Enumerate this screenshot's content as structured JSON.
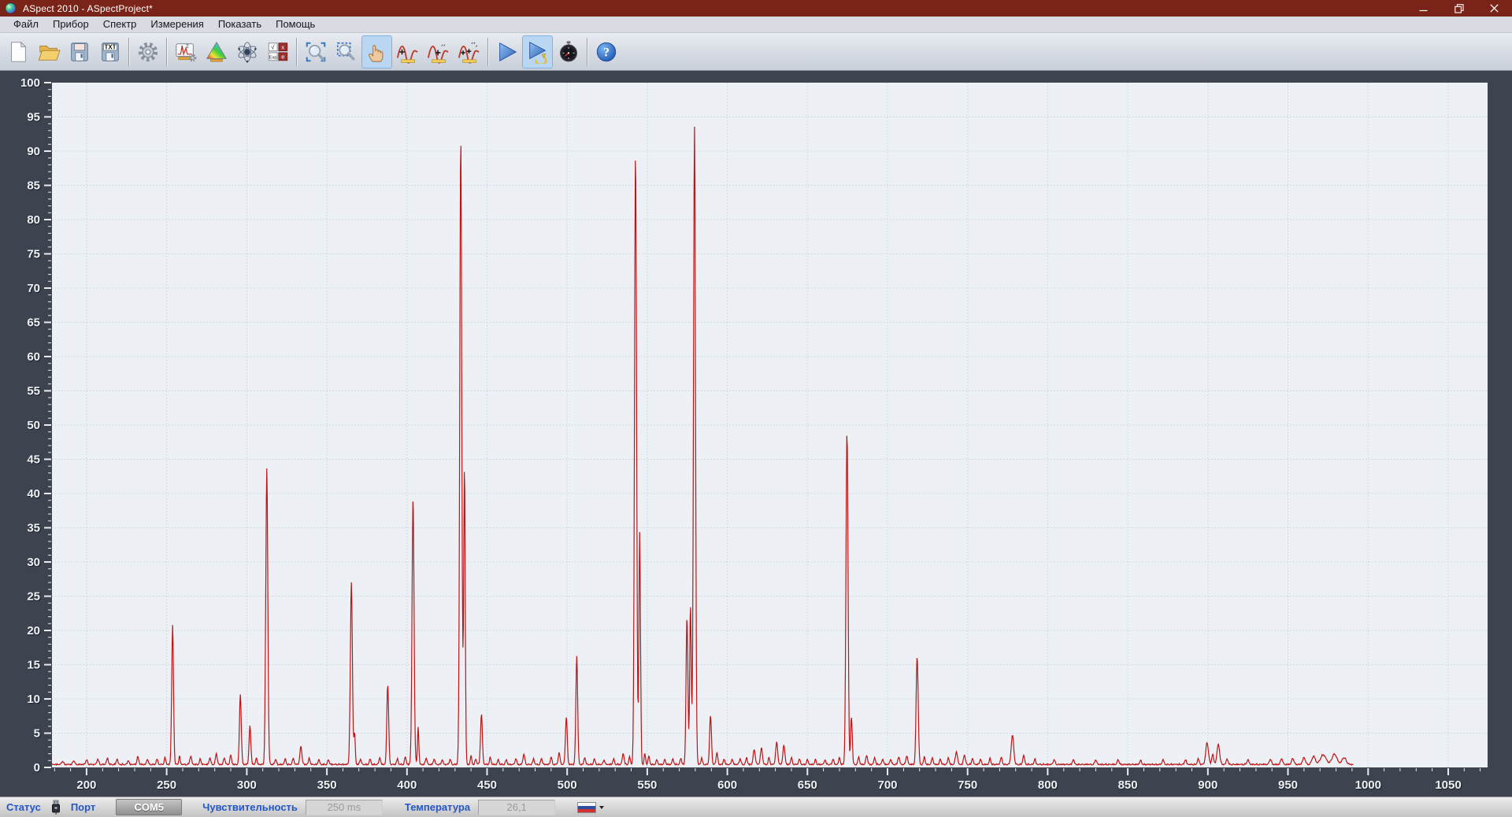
{
  "window": {
    "title": "ASpect 2010 - ASpectProject*",
    "app_icon": "aspect-sphere-icon",
    "controls": [
      "minimize-icon",
      "restore-icon",
      "close-icon"
    ]
  },
  "menu": {
    "items": [
      "Файл",
      "Прибор",
      "Спектр",
      "Измерения",
      "Показать",
      "Помощь"
    ]
  },
  "toolbar": {
    "items": [
      {
        "type": "button",
        "name": "new-file",
        "icon": "new-file-icon"
      },
      {
        "type": "button",
        "name": "open-file",
        "icon": "open-folder-icon"
      },
      {
        "type": "button",
        "name": "save",
        "icon": "save-floppy-icon"
      },
      {
        "type": "button",
        "name": "save-txt",
        "icon": "save-txt-icon"
      },
      {
        "type": "separator"
      },
      {
        "type": "button",
        "name": "settings",
        "icon": "gear-icon"
      },
      {
        "type": "separator"
      },
      {
        "type": "button",
        "name": "measurement-display",
        "icon": "measurement-display-icon"
      },
      {
        "type": "button",
        "name": "color-measurement",
        "icon": "color-triangle-icon"
      },
      {
        "type": "button",
        "name": "spectral-lines",
        "icon": "atom-icon"
      },
      {
        "type": "button",
        "name": "math-functions",
        "icon": "math-grid-icon"
      },
      {
        "type": "separator"
      },
      {
        "type": "button",
        "name": "zoom",
        "icon": "magnifier-icon"
      },
      {
        "type": "button",
        "name": "zoom-selection",
        "icon": "magnifier-selection-icon"
      },
      {
        "type": "button",
        "name": "pan",
        "icon": "hand-icon",
        "active": true
      },
      {
        "type": "button",
        "name": "add-peak",
        "icon": "peak-plus-icon"
      },
      {
        "type": "button",
        "name": "add-peak-marker",
        "icon": "peak-plus-mid-icon"
      },
      {
        "type": "button",
        "name": "add-all-peaks",
        "icon": "peak-plus-all-icon"
      },
      {
        "type": "separator"
      },
      {
        "type": "button",
        "name": "measure-once",
        "icon": "play-icon"
      },
      {
        "type": "button",
        "name": "measure-continuous",
        "icon": "play-loop-icon",
        "active": true
      },
      {
        "type": "button",
        "name": "timer",
        "icon": "stopwatch-icon"
      },
      {
        "type": "separator"
      },
      {
        "type": "button",
        "name": "help",
        "icon": "question-icon"
      }
    ]
  },
  "statusbar": {
    "status_label": "Статус",
    "status_icon": "usb-connector-icon",
    "port_label": "Порт",
    "port_value": "COM5",
    "sensitivity_label": "Чувствительность",
    "sensitivity_value": "250 ms",
    "temperature_label": "Температура",
    "temperature_value": "26,1",
    "language_icon": "russian-flag-icon"
  },
  "colors": {
    "titlebar": "#7a2318",
    "chart_surround": "#3d434f",
    "plot_background": "#edf1f6",
    "grid": "#ccd1dd",
    "trace": "#bb1515",
    "axis_text": "#eef1f5",
    "status_label_blue": "#2456c6",
    "toolbar_active": "#b9d7f2"
  },
  "chart_data": {
    "type": "line",
    "title": "",
    "xlabel": "",
    "ylabel": "",
    "xlim": [
      178.4,
      1074.6
    ],
    "ylim": [
      0,
      100
    ],
    "grid": "dotted",
    "x_major_ticks": [
      200,
      250,
      300,
      350,
      400,
      450,
      500,
      550,
      600,
      650,
      700,
      750,
      800,
      850,
      900,
      950,
      1000,
      1050
    ],
    "x_minor_step": 10,
    "y_major_ticks": [
      0,
      5,
      10,
      15,
      20,
      25,
      30,
      35,
      40,
      45,
      50,
      55,
      60,
      65,
      70,
      75,
      80,
      85,
      90,
      95,
      100
    ],
    "y_minor_step": 1,
    "series": [
      {
        "name": "emission-spectrum",
        "color": "#bb1515",
        "baseline": 0.35,
        "x_start": 178.4,
        "x_end": 991,
        "peaks": [
          [
            185,
            0.5,
            0.8
          ],
          [
            192,
            0.6,
            0.8
          ],
          [
            200,
            0.7,
            0.8
          ],
          [
            207,
            0.8,
            0.8
          ],
          [
            213,
            0.9,
            0.8
          ],
          [
            219,
            0.8,
            0.7
          ],
          [
            226,
            0.6,
            0.7
          ],
          [
            232,
            1.1,
            0.8
          ],
          [
            238,
            0.8,
            0.7
          ],
          [
            244,
            0.8,
            0.7
          ],
          [
            249,
            1.0,
            0.7
          ],
          [
            253.7,
            20.3,
            0.8
          ],
          [
            258,
            1.2,
            0.6
          ],
          [
            265,
            1.2,
            0.8
          ],
          [
            271,
            0.8,
            0.7
          ],
          [
            277,
            1.0,
            0.7
          ],
          [
            281,
            1.6,
            0.8
          ],
          [
            286,
            1.0,
            0.7
          ],
          [
            290,
            1.4,
            0.7
          ],
          [
            296,
            10.3,
            0.8
          ],
          [
            302,
            5.6,
            0.8
          ],
          [
            306,
            1.0,
            0.6
          ],
          [
            312.5,
            43.2,
            0.9
          ],
          [
            318,
            0.8,
            0.7
          ],
          [
            324,
            0.8,
            0.7
          ],
          [
            329,
            0.9,
            0.7
          ],
          [
            333.8,
            2.6,
            0.9
          ],
          [
            339,
            0.9,
            0.7
          ],
          [
            345,
            0.7,
            0.7
          ],
          [
            351,
            0.7,
            0.7
          ],
          [
            365.3,
            26.6,
            0.9
          ],
          [
            367.3,
            4.5,
            0.6
          ],
          [
            371,
            0.8,
            0.7
          ],
          [
            377,
            0.8,
            0.7
          ],
          [
            383,
            1.0,
            0.7
          ],
          [
            388,
            11.7,
            0.8
          ],
          [
            394,
            0.8,
            0.7
          ],
          [
            399,
            1.1,
            0.7
          ],
          [
            403.8,
            38.8,
            0.9
          ],
          [
            407,
            5.5,
            0.6
          ],
          [
            412,
            1.0,
            0.7
          ],
          [
            417,
            0.8,
            0.7
          ],
          [
            422,
            0.7,
            0.7
          ],
          [
            427,
            0.8,
            0.7
          ],
          [
            433.6,
            91.5,
            0.9
          ],
          [
            435.9,
            43.4,
            0.7
          ],
          [
            440,
            1.3,
            0.6
          ],
          [
            443,
            0.8,
            0.7
          ],
          [
            446.5,
            7.3,
            0.8
          ],
          [
            452,
            1.0,
            0.7
          ],
          [
            457,
            0.7,
            0.7
          ],
          [
            462,
            0.7,
            0.7
          ],
          [
            468,
            0.9,
            0.7
          ],
          [
            473,
            1.5,
            0.8
          ],
          [
            479,
            0.8,
            0.7
          ],
          [
            484,
            0.9,
            0.7
          ],
          [
            490,
            1.1,
            0.7
          ],
          [
            495,
            1.7,
            0.8
          ],
          [
            499.5,
            7.0,
            0.8
          ],
          [
            506,
            15.9,
            0.8
          ],
          [
            511,
            1.0,
            0.7
          ],
          [
            517,
            0.8,
            0.7
          ],
          [
            523,
            0.7,
            0.7
          ],
          [
            529,
            0.8,
            0.7
          ],
          [
            535,
            1.6,
            0.8
          ],
          [
            539,
            1.1,
            0.7
          ],
          [
            542.7,
            89.3,
            0.9
          ],
          [
            545.3,
            34.0,
            0.7
          ],
          [
            548.5,
            1.6,
            0.6
          ],
          [
            551,
            1.2,
            0.7
          ],
          [
            556,
            0.7,
            0.7
          ],
          [
            561,
            0.7,
            0.7
          ],
          [
            566,
            0.8,
            0.7
          ],
          [
            571,
            0.9,
            0.7
          ],
          [
            574.8,
            21.4,
            0.8
          ],
          [
            577.0,
            23.4,
            0.7
          ],
          [
            579.5,
            93.1,
            0.9
          ],
          [
            584,
            1.0,
            0.6
          ],
          [
            589.5,
            7.2,
            0.8
          ],
          [
            593.5,
            1.8,
            0.7
          ],
          [
            598,
            0.8,
            0.7
          ],
          [
            603,
            0.8,
            0.7
          ],
          [
            608,
            0.9,
            0.7
          ],
          [
            612,
            1.0,
            0.7
          ],
          [
            616.8,
            2.2,
            0.9
          ],
          [
            621.3,
            2.4,
            0.9
          ],
          [
            626,
            1.0,
            0.7
          ],
          [
            630.8,
            3.2,
            0.9
          ],
          [
            635.3,
            2.8,
            0.9
          ],
          [
            640,
            1.0,
            0.7
          ],
          [
            645,
            0.8,
            0.7
          ],
          [
            650,
            0.7,
            0.7
          ],
          [
            655,
            0.7,
            0.7
          ],
          [
            661,
            0.7,
            0.7
          ],
          [
            666,
            0.8,
            0.7
          ],
          [
            670,
            1.0,
            0.7
          ],
          [
            674.7,
            48.6,
            0.9
          ],
          [
            677.5,
            7.0,
            0.7
          ],
          [
            682,
            1.1,
            0.7
          ],
          [
            687,
            1.3,
            0.8
          ],
          [
            692,
            1.0,
            0.7
          ],
          [
            697,
            0.8,
            0.7
          ],
          [
            702,
            0.8,
            0.7
          ],
          [
            707,
            1.1,
            0.8
          ],
          [
            712,
            1.3,
            0.8
          ],
          [
            718.5,
            15.8,
            0.9
          ],
          [
            723,
            1.1,
            0.7
          ],
          [
            728,
            1.0,
            0.7
          ],
          [
            733,
            0.8,
            0.7
          ],
          [
            738,
            1.0,
            0.7
          ],
          [
            743,
            1.9,
            0.9
          ],
          [
            748,
            1.4,
            0.8
          ],
          [
            753,
            0.9,
            0.7
          ],
          [
            758,
            0.8,
            0.7
          ],
          [
            764,
            0.9,
            0.7
          ],
          [
            771,
            1.0,
            0.8
          ],
          [
            778,
            4.3,
            1.1
          ],
          [
            785,
            1.3,
            0.8
          ],
          [
            792,
            0.8,
            0.7
          ],
          [
            804,
            0.7,
            0.8
          ],
          [
            816,
            0.7,
            0.8
          ],
          [
            830,
            0.7,
            0.8
          ],
          [
            844,
            0.7,
            0.8
          ],
          [
            858,
            0.6,
            0.8
          ],
          [
            872,
            0.7,
            0.8
          ],
          [
            886,
            0.7,
            0.8
          ],
          [
            894,
            0.8,
            0.8
          ],
          [
            899.5,
            3.2,
            1.2
          ],
          [
            903,
            1.5,
            0.8
          ],
          [
            906.5,
            2.9,
            1.2
          ],
          [
            912,
            0.8,
            0.8
          ],
          [
            925,
            0.7,
            0.9
          ],
          [
            939,
            0.8,
            0.9
          ],
          [
            946,
            0.9,
            0.9
          ],
          [
            953,
            0.9,
            1.0
          ],
          [
            960,
            1.0,
            1.2
          ],
          [
            966,
            1.2,
            1.5
          ],
          [
            972,
            1.4,
            2.5
          ],
          [
            979,
            1.5,
            2.2
          ],
          [
            985,
            1.0,
            1.8
          ]
        ]
      }
    ]
  }
}
